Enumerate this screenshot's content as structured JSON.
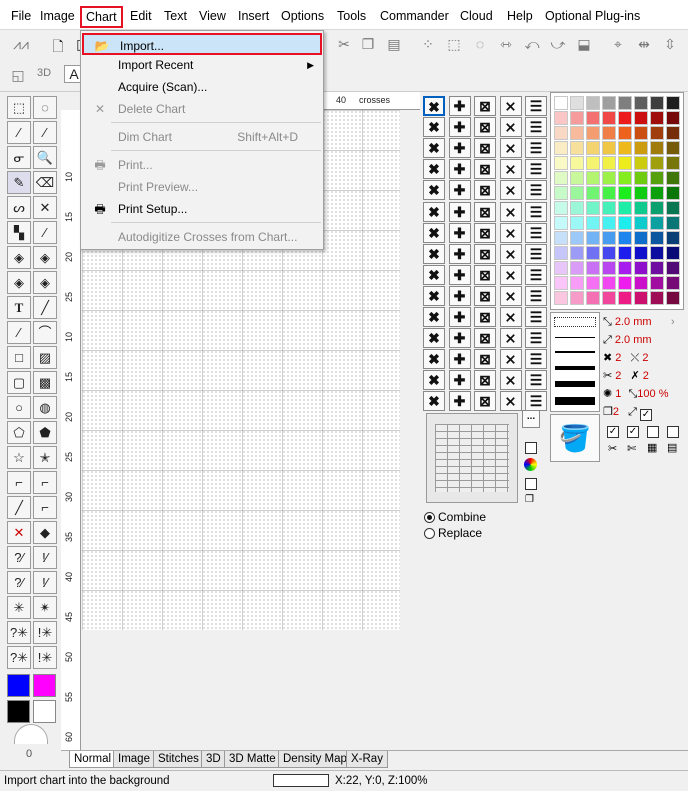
{
  "menubar": {
    "items": [
      "File",
      "Image",
      "Chart",
      "Edit",
      "Text",
      "View",
      "Insert",
      "Options",
      "Tools",
      "Commander",
      "Cloud",
      "Help",
      "Optional Plug-ins"
    ]
  },
  "chart_menu": {
    "items": [
      {
        "label": "Import...",
        "shortcut": "",
        "enabled": true,
        "icon": "import-icon",
        "submenu": false
      },
      {
        "label": "Import Recent",
        "shortcut": "",
        "enabled": true,
        "icon": "",
        "submenu": true
      },
      {
        "label": "Acquire (Scan)...",
        "shortcut": "",
        "enabled": true,
        "icon": "",
        "submenu": false
      },
      {
        "label": "Delete Chart",
        "shortcut": "",
        "enabled": false,
        "icon": "close-icon",
        "submenu": false
      },
      {
        "label": "Dim Chart",
        "shortcut": "Shift+Alt+D",
        "enabled": false,
        "icon": "",
        "submenu": false
      },
      {
        "label": "Print...",
        "shortcut": "",
        "enabled": false,
        "icon": "printer-icon",
        "submenu": false
      },
      {
        "label": "Print Preview...",
        "shortcut": "",
        "enabled": false,
        "icon": "",
        "submenu": false
      },
      {
        "label": "Print Setup...",
        "shortcut": "",
        "enabled": true,
        "icon": "print-setup-icon",
        "submenu": false
      },
      {
        "label": "Autodigitize Crosses from Chart...",
        "shortcut": "",
        "enabled": false,
        "icon": "",
        "submenu": false
      }
    ]
  },
  "ruler": {
    "top_labels": [
      "40",
      "crosses"
    ],
    "left_labels": [
      "10",
      "15",
      "20",
      "25",
      "10",
      "15",
      "20",
      "25",
      "30",
      "35",
      "40",
      "45",
      "50",
      "55",
      "60"
    ]
  },
  "tool_labels": {
    "text_tool": "T",
    "dimension_3d": "3D",
    "text_small": "A"
  },
  "options": {
    "combine": "Combine",
    "replace": "Replace",
    "selected": "combine"
  },
  "properties": {
    "stitch_length_1": "2.0 mm",
    "stitch_length_2": "2.0 mm",
    "strands_full": "2",
    "strands_half": "2",
    "strands_quarter": "2",
    "strands_back": "2",
    "french_knot": "1",
    "zoom": "100 %",
    "count": "2"
  },
  "knob_value": "0",
  "tabs": [
    "Normal",
    "Image",
    "Stitches",
    "3D",
    "3D Matte",
    "Density Map",
    "X-Ray"
  ],
  "active_tab": "Normal",
  "status": {
    "text": "Import chart into the background",
    "coords": "X:22, Y:0, Z:100%"
  },
  "colors": {
    "primary": "#0000ff",
    "secondary": "#ff00ff",
    "fg": "#000000",
    "bg": "#ffffff",
    "highlight": "#e81123",
    "menu_selected": "#cce4f7"
  }
}
